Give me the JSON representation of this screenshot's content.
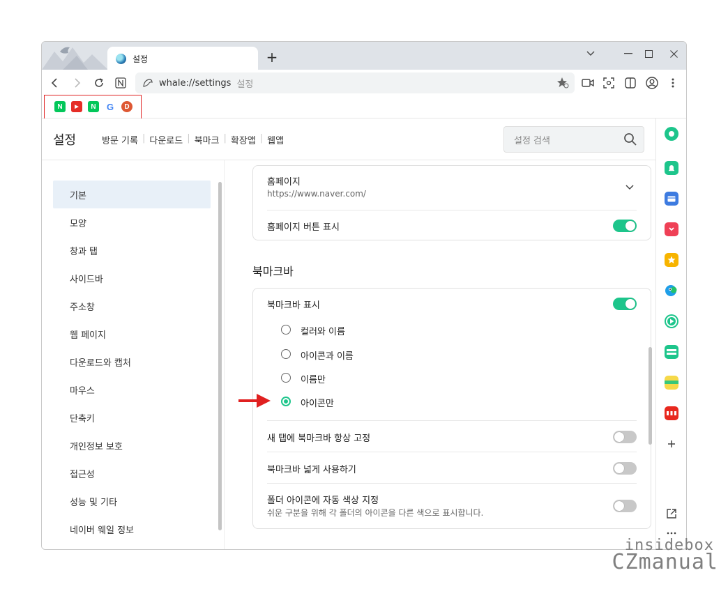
{
  "tab": {
    "title": "설정"
  },
  "address": {
    "url": "whale://settings",
    "page_label": "설정"
  },
  "bookmarks": [
    {
      "letter": "N",
      "color": "#03c75a",
      "icon": "naver-icon"
    },
    {
      "letter": "▶",
      "color": "#e52d27",
      "icon": "youtube-icon"
    },
    {
      "letter": "N",
      "color": "#03c75a",
      "icon": "naver-icon"
    },
    {
      "letter": "G",
      "color": "#ffffff",
      "icon": "google-icon"
    },
    {
      "letter": "D",
      "color": "#de5833",
      "icon": "duckduckgo-icon"
    }
  ],
  "header": {
    "title": "설정",
    "nav": [
      "방문 기록",
      "다운로드",
      "북마크",
      "확장앱",
      "웹앱"
    ],
    "search_placeholder": "설정 검색"
  },
  "sidebar": {
    "items": [
      {
        "label": "기본",
        "active": true
      },
      {
        "label": "모양"
      },
      {
        "label": "창과 탭"
      },
      {
        "label": "사이드바"
      },
      {
        "label": "주소창"
      },
      {
        "label": "웹 페이지"
      },
      {
        "label": "다운로드와 캡처"
      },
      {
        "label": "마우스"
      },
      {
        "label": "단축키"
      },
      {
        "label": "개인정보 보호"
      },
      {
        "label": "접근성"
      },
      {
        "label": "성능 및 기타"
      },
      {
        "label": "네이버 웨일 정보"
      }
    ]
  },
  "homepage_card": {
    "title": "홈페이지",
    "url": "https://www.naver.com/",
    "button_label": "홈페이지 버튼 표시",
    "button_on": true
  },
  "bookmarkbar": {
    "section_title": "북마크바",
    "show_label": "북마크바 표시",
    "show_on": true,
    "options": [
      {
        "label": "컬러와 이름",
        "selected": false
      },
      {
        "label": "아이콘과 이름",
        "selected": false
      },
      {
        "label": "이름만",
        "selected": false
      },
      {
        "label": "아이콘만",
        "selected": true
      }
    ],
    "always_label": "새 탭에 북마크바 항상 고정",
    "always_on": false,
    "wide_label": "북마크바 넓게 사용하기",
    "wide_on": false,
    "folder_label": "폴더 아이콘에 자동 색상 지정",
    "folder_desc": "쉬운 구분을 위해 각 폴더의 아이콘을 다른 색으로 표시합니다.",
    "folder_on": false
  },
  "right_sidebar_icons": [
    "whale-dot-icon",
    "alarm-icon",
    "wallet-icon",
    "pocket-icon",
    "star-icon",
    "papago-icon",
    "video-icon",
    "webtoon-icon",
    "memo-icon",
    "now-icon",
    "add-icon",
    "external-link-icon",
    "more-icon"
  ],
  "watermark": {
    "line1": "insidebox",
    "line2": "CZmanual"
  }
}
